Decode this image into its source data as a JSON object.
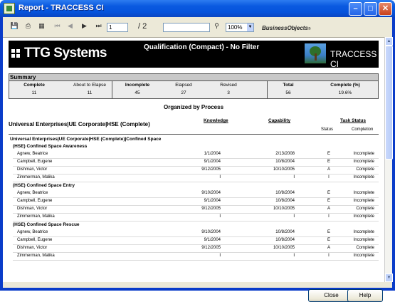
{
  "window": {
    "title": "Report - TRACCESS CI"
  },
  "toolbar": {
    "page_value": "1",
    "page_total": "/ 2",
    "search_value": "",
    "zoom_value": "100%",
    "brand": "BusinessObjects",
    "brand_mark": "®"
  },
  "banner": {
    "company": "TTG Systems",
    "title": "Qualification (Compact) - No Filter",
    "brand": "TRACCESS CI"
  },
  "summary": {
    "heading": "Summary",
    "columns": [
      {
        "label": "Complete",
        "value": "11",
        "bold": true
      },
      {
        "label": "About to Elapse",
        "value": "11",
        "bold": false
      },
      {
        "label": "Incomplete",
        "value": "45",
        "bold": true
      },
      {
        "label": "Elapsed",
        "value": "27",
        "bold": false
      },
      {
        "label": "Revised",
        "value": "3",
        "bold": false
      },
      {
        "label": "Total",
        "value": "56",
        "bold": true
      },
      {
        "label": "Complete (%)",
        "value": "19.6%",
        "bold": true
      }
    ]
  },
  "report": {
    "organized_by": "Organized by Process",
    "group_title": "Universal Enterprises|UE Corporate|HSE (Complete)",
    "col_knowledge": "Knowledge",
    "col_capability": "Capability",
    "col_task_status": "Task Status",
    "col_status": "Status",
    "col_completion": "Completion",
    "process_path": "Universal Enterprises|UE Corporate|HSE (Complete)|Confined Space",
    "sections": [
      {
        "title": "(HSE) Confined Space Awareness",
        "rows": [
          {
            "name": "Agnew, Beatrice",
            "knowledge": "1/1/2004",
            "capability": "2/13/2008",
            "status": "E",
            "completion": "Incomplete"
          },
          {
            "name": "Campbell, Eugene",
            "knowledge": "9/1/2004",
            "capability": "10/8/2004",
            "status": "E",
            "completion": "Incomplete"
          },
          {
            "name": "Dishman, Victor",
            "knowledge": "9/12/2005",
            "capability": "10/10/2005",
            "status": "A",
            "completion": "Complete"
          },
          {
            "name": "Zimmerman, Malika",
            "knowledge": "I",
            "capability": "I",
            "status": "I",
            "completion": "Incomplete"
          }
        ]
      },
      {
        "title": "(HSE) Confined Space Entry",
        "rows": [
          {
            "name": "Agnew, Beatrice",
            "knowledge": "9/10/2004",
            "capability": "10/8/2004",
            "status": "E",
            "completion": "Incomplete"
          },
          {
            "name": "Campbell, Eugene",
            "knowledge": "9/1/2004",
            "capability": "10/8/2004",
            "status": "E",
            "completion": "Incomplete"
          },
          {
            "name": "Dishman, Victor",
            "knowledge": "9/12/2005",
            "capability": "10/10/2005",
            "status": "A",
            "completion": "Complete"
          },
          {
            "name": "Zimmerman, Malika",
            "knowledge": "I",
            "capability": "I",
            "status": "I",
            "completion": "Incomplete"
          }
        ]
      },
      {
        "title": "(HSE) Confined Space Rescue",
        "rows": [
          {
            "name": "Agnew, Beatrice",
            "knowledge": "9/10/2004",
            "capability": "10/8/2004",
            "status": "E",
            "completion": "Incomplete"
          },
          {
            "name": "Campbell, Eugene",
            "knowledge": "9/1/2004",
            "capability": "10/8/2004",
            "status": "E",
            "completion": "Incomplete"
          },
          {
            "name": "Dishman, Victor",
            "knowledge": "9/12/2005",
            "capability": "10/10/2005",
            "status": "A",
            "completion": "Complete"
          },
          {
            "name": "Zimmerman, Malika",
            "knowledge": "I",
            "capability": "I",
            "status": "I",
            "completion": "Incomplete"
          }
        ]
      }
    ]
  },
  "buttons": {
    "close": "Close",
    "help": "Help"
  },
  "colors": {
    "titlebar": "#0553dc",
    "banner": "#000000",
    "summary_head": "#c8c8c8"
  }
}
